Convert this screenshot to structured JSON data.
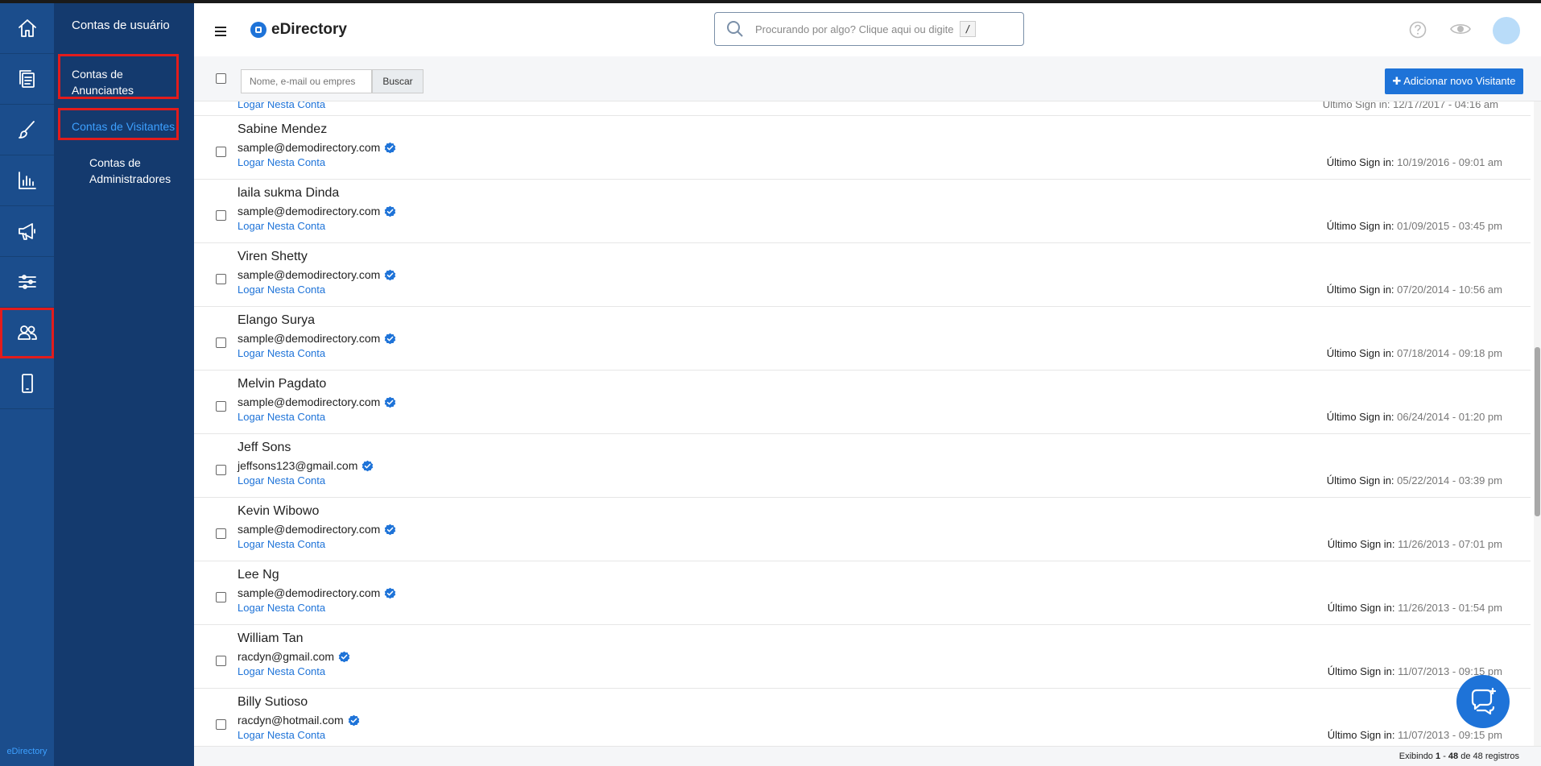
{
  "rail": {
    "brand": "eDirectory"
  },
  "subnav": {
    "title": "Contas de usuário",
    "items": [
      "Contas de Anunciantes",
      "Contas de Visitantes",
      "Contas de Administradores"
    ]
  },
  "header": {
    "logo": "eDirectory",
    "search_placeholder": "Procurando por algo? Clique aqui ou digite",
    "search_shortcut": "/"
  },
  "toolbar": {
    "filter_placeholder": "Nome, e-mail ou empres",
    "search_button": "Buscar",
    "add_button": "Adicionar novo Visitante"
  },
  "partial_row": {
    "link": "Logar Nesta Conta",
    "last_label": "Último Sign in:",
    "last_value": "12/17/2017 - 04:16 am"
  },
  "rows": [
    {
      "name": "Sabine Mendez",
      "email": "sample@demodirectory.com",
      "link": "Logar Nesta Conta",
      "last_label": "Último Sign in:",
      "last_value": "10/19/2016 - 09:01 am"
    },
    {
      "name": "laila sukma Dinda",
      "email": "sample@demodirectory.com",
      "link": "Logar Nesta Conta",
      "last_label": "Último Sign in:",
      "last_value": "01/09/2015 - 03:45 pm"
    },
    {
      "name": "Viren Shetty",
      "email": "sample@demodirectory.com",
      "link": "Logar Nesta Conta",
      "last_label": "Último Sign in:",
      "last_value": "07/20/2014 - 10:56 am"
    },
    {
      "name": "Elango Surya",
      "email": "sample@demodirectory.com",
      "link": "Logar Nesta Conta",
      "last_label": "Último Sign in:",
      "last_value": "07/18/2014 - 09:18 pm"
    },
    {
      "name": "Melvin Pagdato",
      "email": "sample@demodirectory.com",
      "link": "Logar Nesta Conta",
      "last_label": "Último Sign in:",
      "last_value": "06/24/2014 - 01:20 pm"
    },
    {
      "name": "Jeff Sons",
      "email": "jeffsons123@gmail.com",
      "link": "Logar Nesta Conta",
      "last_label": "Último Sign in:",
      "last_value": "05/22/2014 - 03:39 pm"
    },
    {
      "name": "Kevin Wibowo",
      "email": "sample@demodirectory.com",
      "link": "Logar Nesta Conta",
      "last_label": "Último Sign in:",
      "last_value": "11/26/2013 - 07:01 pm"
    },
    {
      "name": "Lee Ng",
      "email": "sample@demodirectory.com",
      "link": "Logar Nesta Conta",
      "last_label": "Último Sign in:",
      "last_value": "11/26/2013 - 01:54 pm"
    },
    {
      "name": "William Tan",
      "email": "racdyn@gmail.com",
      "link": "Logar Nesta Conta",
      "last_label": "Último Sign in:",
      "last_value": "11/07/2013 - 09:15 pm"
    },
    {
      "name": "Billy Sutioso",
      "email": "racdyn@hotmail.com",
      "link": "Logar Nesta Conta",
      "last_label": "Último Sign in:",
      "last_value": "11/07/2013 - 09:15 pm"
    }
  ],
  "footer": {
    "prefix": "Exibindo",
    "from": "1",
    "sep": "-",
    "to": "48",
    "of": "de 48 registros"
  },
  "colors": {
    "rail": "#1b4d8c",
    "subnav": "#143a6e",
    "accent": "#1e73d8",
    "highlight": "#e21c1c"
  },
  "icons": {
    "rail": [
      "home-icon",
      "pages-icon",
      "brush-icon",
      "chart-icon",
      "megaphone-icon",
      "sliders-icon",
      "users-icon",
      "mobile-icon"
    ],
    "header": [
      "search-icon",
      "help-icon",
      "eye-icon"
    ],
    "row": "verified-icon",
    "chat": "chat-icon"
  }
}
